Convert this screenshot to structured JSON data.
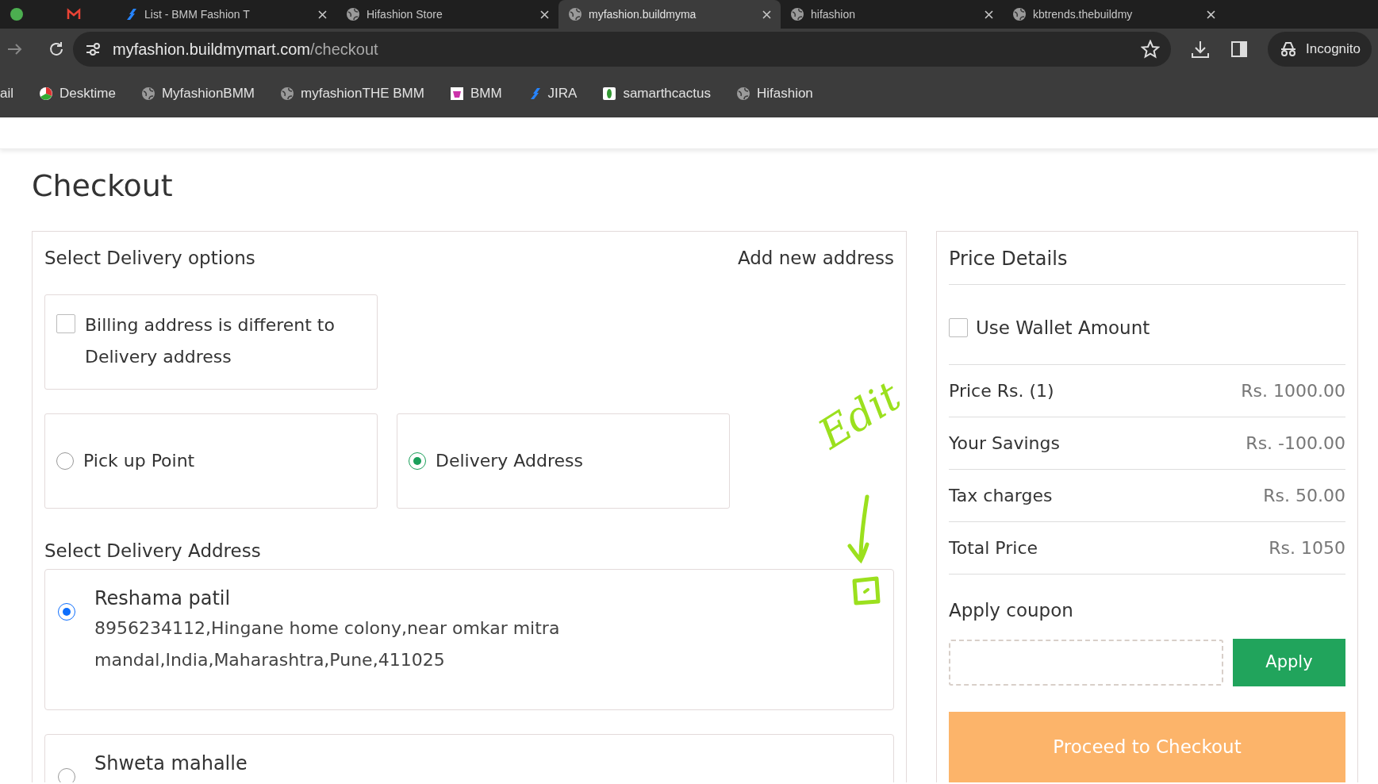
{
  "browser": {
    "tabs": [
      {
        "selected": false
      },
      {
        "selected": false
      },
      {
        "title": "List - BMM Fashion T",
        "selected": false
      },
      {
        "title": "Hifashion Store",
        "selected": false
      },
      {
        "title": "myfashion.buildmyma",
        "selected": true
      },
      {
        "title": "hifashion",
        "selected": false
      },
      {
        "title": "kbtrends.thebuildmy",
        "selected": false
      }
    ],
    "url_host": "myfashion.buildmymart.com",
    "url_path": "/checkout",
    "profile": "Incognito",
    "bookmarks": [
      {
        "label": "ail"
      },
      {
        "label": "Desktime"
      },
      {
        "label": "MyfashionBMM"
      },
      {
        "label": "myfashionTHE BMM"
      },
      {
        "label": "BMM"
      },
      {
        "label": "JIRA"
      },
      {
        "label": "samarthcactus"
      },
      {
        "label": "Hifashion"
      }
    ]
  },
  "page": {
    "title": "Checkout",
    "delivery": {
      "heading": "Select Delivery options",
      "add_new": "Add new address",
      "billing": {
        "label": "Billing address is different to Delivery address",
        "checked": false
      },
      "options": [
        {
          "label": "Pick up Point",
          "selected": false
        },
        {
          "label": "Delivery Address",
          "selected": true
        }
      ],
      "address_heading": "Select Delivery Address",
      "addresses": [
        {
          "name": "Reshama patil",
          "details": "8956234112,Hingane home colony,near omkar mitra mandal,India,Maharashtra,Pune,411025",
          "selected": true
        },
        {
          "name": "Shweta mahalle",
          "selected": false
        }
      ]
    },
    "price": {
      "heading": "Price Details",
      "wallet": {
        "label": "Use Wallet Amount",
        "checked": false
      },
      "rows": [
        {
          "label": "Price Rs. (1)",
          "value": "Rs. 1000.00"
        },
        {
          "label": "Your Savings",
          "value": "Rs. -100.00"
        },
        {
          "label": "Tax charges",
          "value": "Rs. 50.00"
        },
        {
          "label": "Total Price",
          "value": "Rs. 1050"
        }
      ],
      "coupon_heading": "Apply coupon",
      "apply": "Apply",
      "checkout": "Proceed to Checkout"
    }
  },
  "annotation": {
    "text": "Edit"
  }
}
